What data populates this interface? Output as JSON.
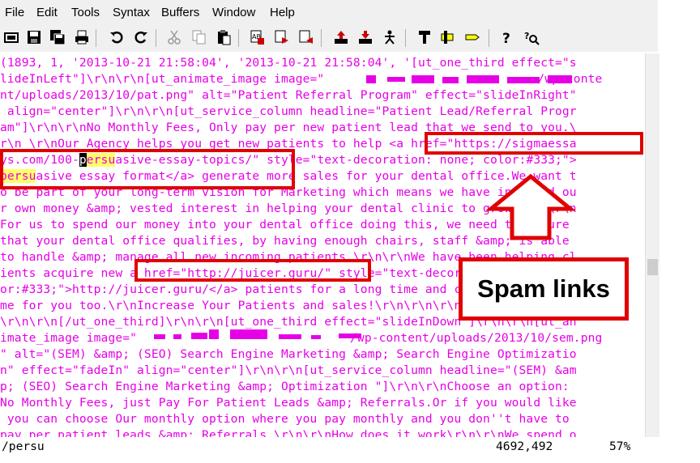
{
  "menu": [
    "File",
    "Edit",
    "Tools",
    "Syntax",
    "Buffers",
    "Window",
    "Help"
  ],
  "toolbar_icons": [
    "open-icon",
    "save-icon",
    "save-all-icon",
    "print-icon",
    "undo-icon",
    "redo-icon",
    "cut-icon",
    "copy-icon",
    "paste-icon",
    "replace-icon",
    "find-next-icon",
    "find-prev-icon",
    "load-session-icon",
    "save-session-icon",
    "run-script-icon",
    "make-icon",
    "build-tags-icon",
    "jump-tag-icon",
    "help-icon",
    "find-help-icon"
  ],
  "editor": {
    "lines": [
      "(1893, 1, '2013-10-21 21:58:04', '2013-10-21 21:58:04', '[ut_one_third effect=\"s",
      "lideInLeft\"]\\r\\n\\r\\n[ut_animate_image image=\"",
      "nt/uploads/2013/10/pat.png\" alt=\"Patient Referral Program\" effect=\"slideInRight\"",
      " align=\"center\"]\\r\\n\\r\\n[ut_service_column headline=\"Patient Lead/Referral Progr",
      "am\"]\\r\\n\\r\\nNo Monthly Fees, Only pay per new patient lead that we send to you.\\",
      "r\\n \\r\\nOur Agency helps you get new patients to help <a href=\"https://sigmaessa",
      "ys.com/100-",
      "asive essay format</a> generate more sales for your dental office.We want t",
      "o be part of your long-term vision for Marketing which means we have invested ou",
      "r own money &amp; vested interest in helping your dental clinic to grow.\\r\\n\\r\\n",
      "For us to spend our money into your dental office doing this, we need to ensure",
      "that your dental office qualifies, by having enough chairs, staff &amp; is able",
      "to handle &amp; manage all new incoming patients.\\r\\n\\r\\nWe have been helping cl",
      "ients acquire new a href=\"http://juicer.guru/\" style=\"text-decoration: none; col",
      "or:#333;\">http://juicer.guru/</a> patients for a long time and can do the sa",
      "me for you too.\\r\\nIncrease Your Patients and sales!\\r\\n\\r\\n\\r\\n\\r\\n\\r\\n\\r\\n]",
      "\\r\\n\\r\\n[/ut_one_third]\\r\\n\\r\\n[ut_one_third effect=\"slideInDown\"]\\r\\n\\r\\n[ut_an",
      "imate_image image=\"",
      "\" alt=\"(SEM) &amp; (SEO) Search Engine Marketing &amp; Search Engine Optimizatio",
      "n\" effect=\"fadeIn\" align=\"center\"]\\r\\n\\r\\n[ut_service_column headline=\"(SEM) &am",
      "p; (SEO) Search Engine Marketing &amp; Optimization \"]\\r\\n\\r\\nChoose an option:",
      "No Monthly Fees, just Pay For Patient Leads &amp; Referrals.Or if you would like",
      " you can choose Our monthly option where you pay monthly and you don''t have to",
      "pay per patient leads &amp; Referrals.\\r\\n\\r\\nHow does it work\\r\\n\\r\\nWe spend o"
    ],
    "line2_tail": "/wp-conte",
    "line7_cursor": "p",
    "line7_highlight": "ersu",
    "line7_tail": "asive-essay-topics/\" style=\"text-decoration: none; color:#333;\">",
    "line8_highlight": "persu",
    "line18_tail": "/wp-content/uploads/2013/10/sem.png"
  },
  "status": {
    "command": "/persu",
    "position": "4692,492",
    "percent": "57%"
  },
  "annotation": {
    "label": "Spam links",
    "color": "#e00000"
  }
}
